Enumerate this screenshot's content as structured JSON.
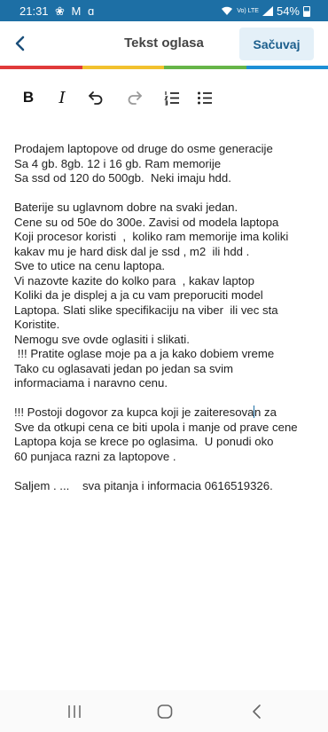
{
  "status_bar": {
    "time": "21:31",
    "left_icons": "❀ M ɑ",
    "right_icons": "Vo) LTE",
    "battery_text": "54%"
  },
  "app_bar": {
    "title": "Tekst oglasa",
    "save_label": "Sačuvaj",
    "back_icon": "back-arrow-icon"
  },
  "color_strip": [
    "#e03a3a",
    "#f2c12e",
    "#66b548",
    "#1d8fd6"
  ],
  "toolbar": {
    "bold_label": "B",
    "italic_label": "I",
    "icons": [
      "undo-icon",
      "redo-icon",
      "numbered-list-icon",
      "bulleted-list-icon"
    ]
  },
  "editor": {
    "lines": [
      "Prodajem laptopove od druge do osme generacije",
      "Sa 4 gb. 8gb. 12 i 16 gb. Ram memorije",
      "Sa ssd od 120 do 500gb.  Neki imaju hdd.",
      "",
      "Baterije su uglavnom dobre na svaki jedan.",
      "Cene su od 50e do 300e. Zavisi od modela laptopa",
      "Koji procesor koristi  ,  koliko ram memorije ima koliki",
      "kakav mu je hard disk dal je ssd , m2  ili hdd .",
      "Sve to utice na cenu laptopa.",
      "Vi nazovte kazite do kolko para  , kakav laptop",
      "Koliki da je displej a ja cu vam preporuciti model",
      "Laptopa. Slati slike specifikaciju na viber  ili vec sta",
      "Koristite.",
      "Nemogu sve ovde oglasiti i slikati.",
      " !!! Pratite oglase moje pa a ja kako dobiem vreme",
      "Tako cu oglasavati jedan po jedan sa svim",
      "informaciama i naravno cenu.",
      "",
      "!!! Postoji dogovor za kupca koji je zaiteresovan za",
      "Sve da otkupi cena ce biti upola i manje od prave cene",
      "Laptopa koja se krece po oglasima.  U ponudi oko",
      "60 punjaca razni za laptopove .",
      "",
      "Saljem . ...    sva pitanja i informacia 0616519326."
    ],
    "caret_line": 18,
    "caret_after": "!!! Postoji dogovor za kupca koji je zaiteresova",
    "caret_rest": "n za"
  },
  "nav_bar": {
    "icons": [
      "recent-apps-icon",
      "home-icon",
      "back-icon"
    ]
  }
}
